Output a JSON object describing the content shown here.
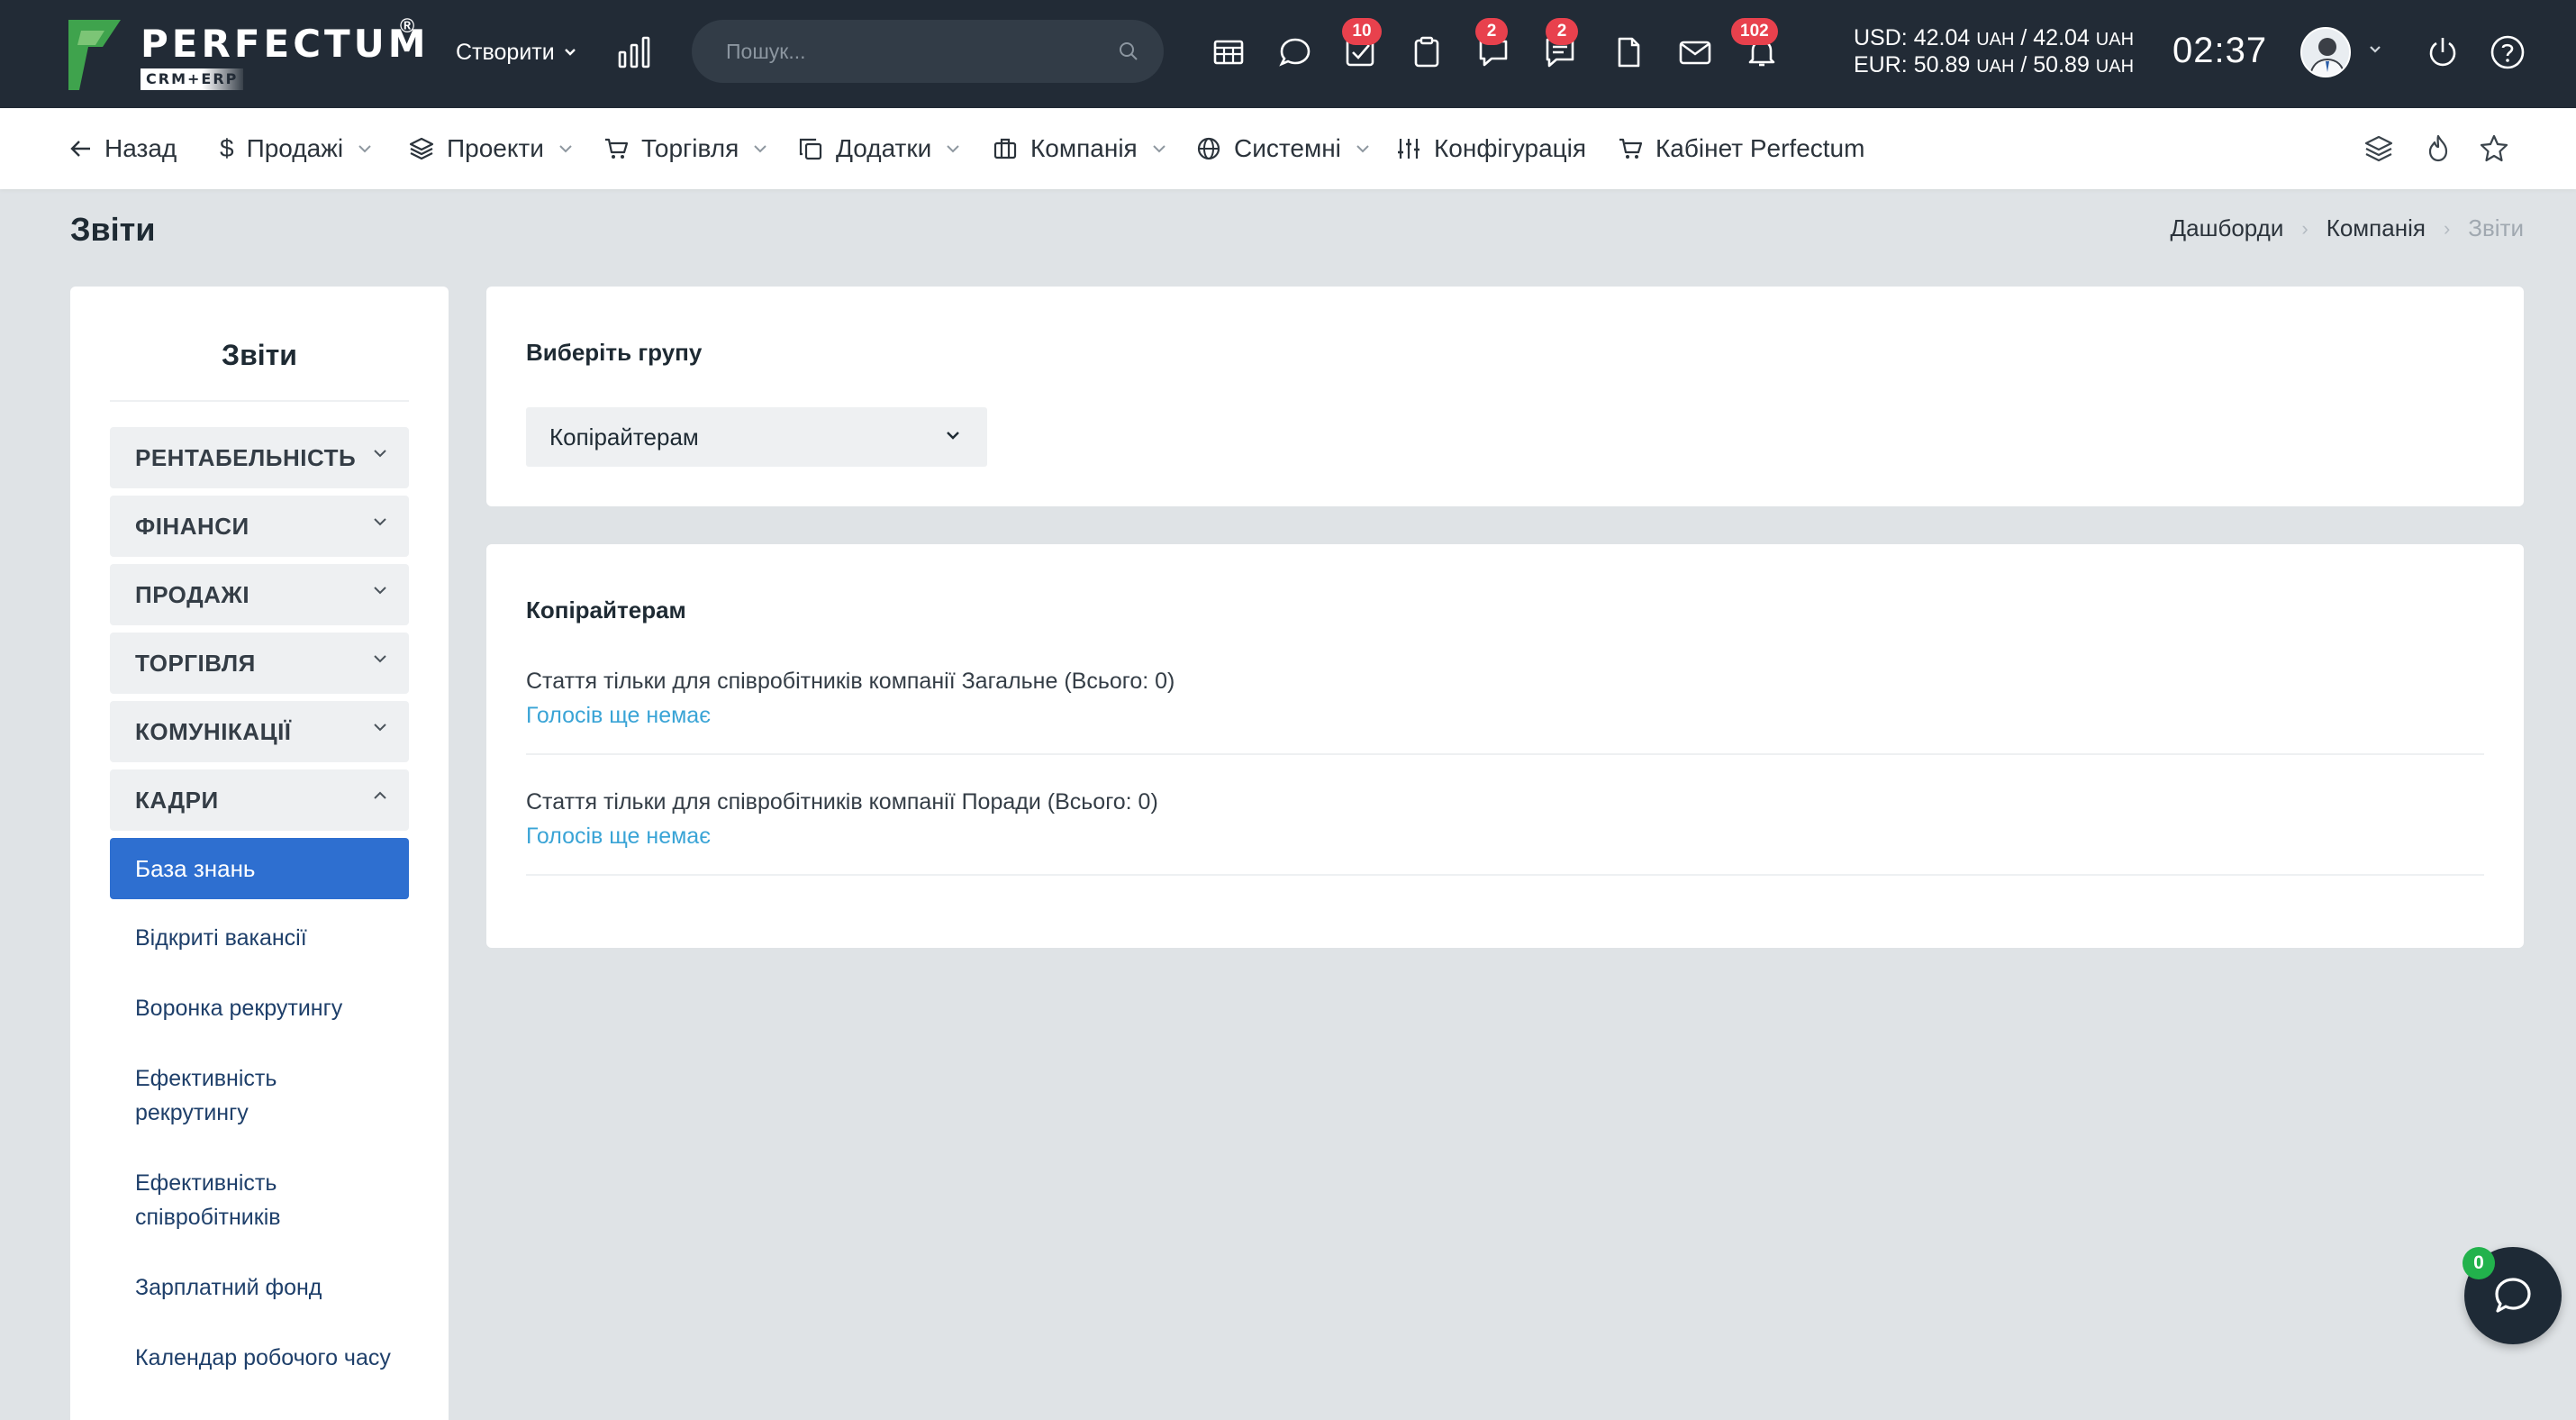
{
  "brand": {
    "name": "PERFECTUM",
    "registered": "®",
    "tagline": "CRM+ERP",
    "colors": {
      "logo_green": "#3fa34d",
      "topbar": "#222b36",
      "accent_blue": "#2e6fd0",
      "link_blue": "#3aa4d6",
      "badge_red": "#e8414d"
    }
  },
  "topbar": {
    "create_label": "Створити",
    "search_placeholder": "Пошук...",
    "icons": [
      "table-icon",
      "chat-icon",
      "tasks-icon",
      "clipboard-icon",
      "comments-icon",
      "messages-icon",
      "document-icon",
      "mail-icon",
      "bell-icon"
    ],
    "badges": {
      "tasks": "10",
      "comments": "2",
      "messages": "2",
      "notifications": "102"
    },
    "rates": {
      "usd_label": "USD:",
      "usd_buy": "42.04",
      "usd_sell": "42.04",
      "eur_label": "EUR:",
      "eur_buy": "50.89",
      "eur_sell": "50.89",
      "currency": "UAH"
    },
    "time": "02:37"
  },
  "nav": {
    "back": "Назад",
    "items": [
      {
        "label": "Продажі"
      },
      {
        "label": "Проекти"
      },
      {
        "label": "Торгівля"
      },
      {
        "label": "Додатки"
      },
      {
        "label": "Компанія"
      },
      {
        "label": "Системні"
      },
      {
        "label": "Конфігурація"
      },
      {
        "label": "Кабінет Perfectum"
      }
    ]
  },
  "page": {
    "title": "Звіти",
    "breadcrumb": [
      "Дашборди",
      "Компанія",
      "Звіти"
    ]
  },
  "sidebar": {
    "title": "Звіти",
    "groups": [
      {
        "label": "РЕНТАБЕЛЬНІСТЬ",
        "expanded": false
      },
      {
        "label": "ФІНАНСИ",
        "expanded": false
      },
      {
        "label": "ПРОДАЖІ",
        "expanded": false
      },
      {
        "label": "ТОРГІВЛЯ",
        "expanded": false
      },
      {
        "label": "КОМУНІКАЦІЇ",
        "expanded": false
      },
      {
        "label": "КАДРИ",
        "expanded": true
      }
    ],
    "active_item": "База знань",
    "links": [
      "Відкриті вакансії",
      "Воронка рекрутингу",
      "Ефективність рекрутингу",
      "Ефективність співробітників",
      "Зарплатний фонд",
      "Календар робочого часу"
    ]
  },
  "group_card": {
    "label": "Виберіть групу",
    "selected": "Копірайтерам"
  },
  "results_card": {
    "title": "Копірайтерам",
    "articles": [
      {
        "title": "Стаття тільки для співробітників компанії Загальне (Всього: 0)",
        "votes": "Голосів ще немає"
      },
      {
        "title": "Стаття тільки для співробітників компанії Поради (Всього: 0)",
        "votes": "Голосів ще немає"
      }
    ]
  },
  "chat": {
    "unread": "0"
  }
}
